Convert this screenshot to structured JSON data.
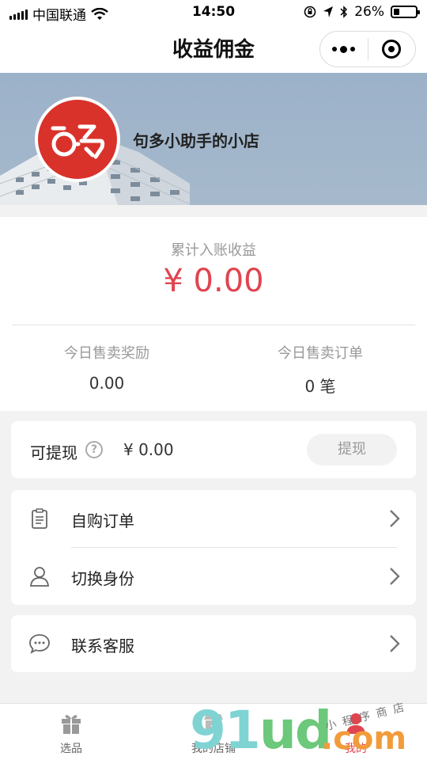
{
  "status_bar": {
    "carrier": "中国联通",
    "time": "14:50",
    "battery": "26%",
    "battery_level": 0.26
  },
  "navbar": {
    "title": "收益佣金"
  },
  "shop": {
    "name": "句多小助手的小店"
  },
  "earnings": {
    "label": "累计入账收益",
    "amount": "¥ 0.00",
    "today_reward_label": "今日售卖奖励",
    "today_reward_value": "0.00",
    "today_orders_label": "今日售卖订单",
    "today_orders_value": "0 笔"
  },
  "withdraw": {
    "label": "可提现",
    "help": "?",
    "value": "¥ 0.00",
    "button": "提现"
  },
  "menu": {
    "items": [
      {
        "label": "自购订单",
        "icon": "clipboard-icon"
      },
      {
        "label": "切换身份",
        "icon": "user-icon"
      },
      {
        "label": "联系客服",
        "icon": "chat-icon"
      }
    ]
  },
  "tabbar": {
    "tabs": [
      {
        "label": "选品",
        "icon": "gift-icon"
      },
      {
        "label": "我的店铺",
        "icon": "shop-icon"
      },
      {
        "label": "我的",
        "icon": "user-icon"
      }
    ]
  },
  "watermark": {
    "brand": "91ud",
    "domain": ".com",
    "tagline": "小程序商店"
  },
  "colors": {
    "accent": "#e0444f",
    "logo_red": "#d9322b",
    "banner": "#9cb2c9"
  }
}
